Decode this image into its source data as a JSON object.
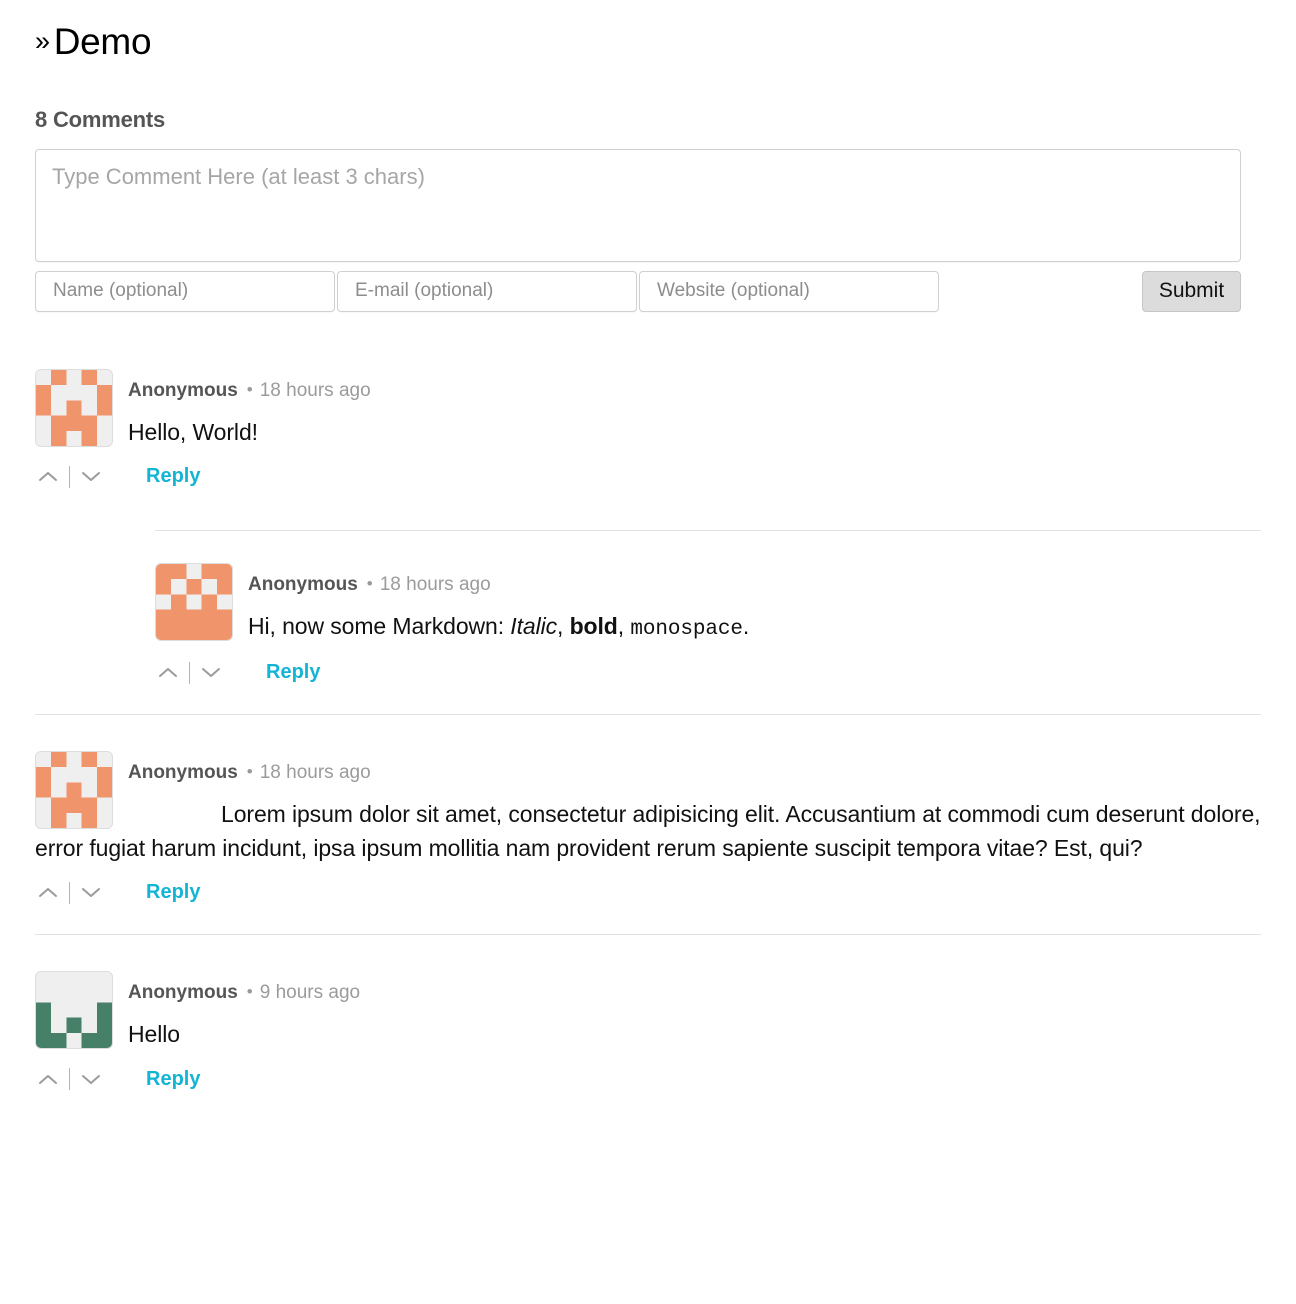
{
  "header": {
    "chevron": "»",
    "title": "Demo",
    "comment_count_label": "8 Comments"
  },
  "postbox": {
    "textarea_placeholder": "Type Comment Here (at least 3 chars)",
    "textarea_value": "",
    "name_placeholder": "Name (optional)",
    "name_value": "",
    "email_placeholder": "E-mail (optional)",
    "email_value": "",
    "website_placeholder": "Website (optional)",
    "website_value": "",
    "submit_label": "Submit"
  },
  "labels": {
    "reply": "Reply",
    "separator": "•",
    "upvote_icon": "chevron-up-icon",
    "downvote_icon": "chevron-down-icon"
  },
  "colors": {
    "link": "#13b4d4",
    "author": "#555555",
    "time": "#9b9b9b",
    "avatar_orange": "#f0946c",
    "avatar_green": "#478068",
    "avatar_bg": "#efefef",
    "divider": "#e2e2e2",
    "submit_bg": "#dcdcdc"
  },
  "comments": [
    {
      "author": "Anonymous",
      "time": "18 hours ago",
      "text": "Hello, World!",
      "reply": "Reply",
      "avatar": {
        "name": "identicon-avatar-orange-a",
        "color": "#f0946c",
        "grid": [
          [
            0,
            1,
            0,
            1,
            0
          ],
          [
            1,
            0,
            0,
            0,
            1
          ],
          [
            1,
            0,
            1,
            0,
            1
          ],
          [
            0,
            1,
            1,
            1,
            0
          ],
          [
            0,
            1,
            0,
            1,
            0
          ]
        ]
      },
      "children": [
        {
          "author": "Anonymous",
          "time": "18 hours ago",
          "text_parts": [
            {
              "type": "plain",
              "text": "Hi, now some Markdown: "
            },
            {
              "type": "italic",
              "text": "Italic"
            },
            {
              "type": "plain",
              "text": ", "
            },
            {
              "type": "bold",
              "text": "bold"
            },
            {
              "type": "plain",
              "text": ", "
            },
            {
              "type": "code",
              "text": "monospace"
            },
            {
              "type": "plain",
              "text": "."
            }
          ],
          "reply": "Reply",
          "avatar": {
            "name": "identicon-avatar-orange-b",
            "color": "#f0946c",
            "grid": [
              [
                1,
                1,
                0,
                1,
                1
              ],
              [
                1,
                0,
                1,
                0,
                1
              ],
              [
                0,
                1,
                0,
                1,
                0
              ],
              [
                1,
                1,
                1,
                1,
                1
              ],
              [
                1,
                1,
                1,
                1,
                1
              ]
            ]
          }
        }
      ]
    },
    {
      "author": "Anonymous",
      "time": "18 hours ago",
      "text": "Lorem ipsum dolor sit amet, consectetur adipisicing elit. Accusantium at commodi cum deserunt dolore, error fugiat harum incidunt, ipsa ipsum mollitia nam provident rerum sapiente suscipit tempora vitae? Est, qui?",
      "reply": "Reply",
      "avatar": {
        "name": "identicon-avatar-orange-a",
        "color": "#f0946c",
        "grid": [
          [
            0,
            1,
            0,
            1,
            0
          ],
          [
            1,
            0,
            0,
            0,
            1
          ],
          [
            1,
            0,
            1,
            0,
            1
          ],
          [
            0,
            1,
            1,
            1,
            0
          ],
          [
            0,
            1,
            0,
            1,
            0
          ]
        ]
      },
      "children": []
    },
    {
      "author": "Anonymous",
      "time": "9 hours ago",
      "text": "Hello",
      "reply": "Reply",
      "avatar": {
        "name": "identicon-avatar-green",
        "color": "#478068",
        "grid": [
          [
            0,
            0,
            0,
            0,
            0
          ],
          [
            0,
            0,
            0,
            0,
            0
          ],
          [
            1,
            0,
            0,
            0,
            1
          ],
          [
            1,
            0,
            1,
            0,
            1
          ],
          [
            1,
            1,
            0,
            1,
            1
          ]
        ]
      },
      "children": []
    }
  ]
}
